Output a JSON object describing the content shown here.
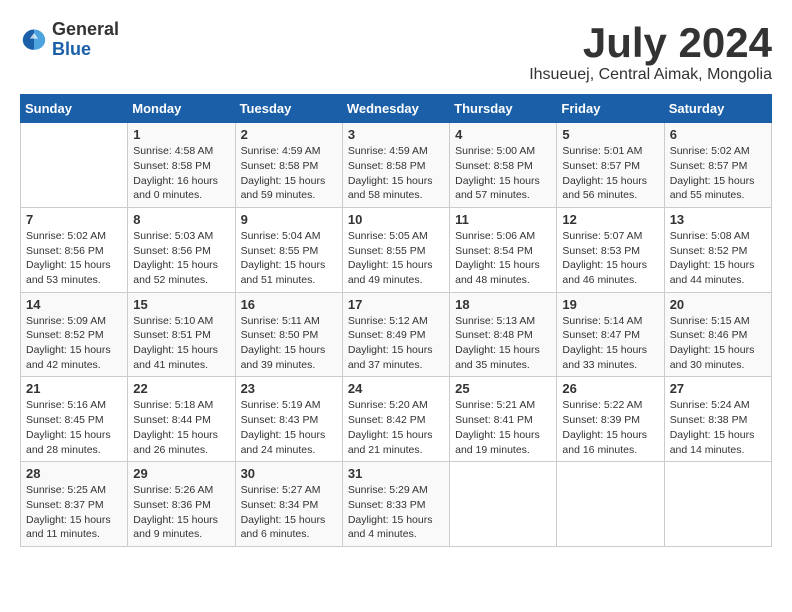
{
  "logo": {
    "general": "General",
    "blue": "Blue"
  },
  "title": {
    "month": "July 2024",
    "location": "Ihsueuej, Central Aimak, Mongolia"
  },
  "headers": [
    "Sunday",
    "Monday",
    "Tuesday",
    "Wednesday",
    "Thursday",
    "Friday",
    "Saturday"
  ],
  "weeks": [
    [
      {
        "day": "",
        "info": ""
      },
      {
        "day": "1",
        "info": "Sunrise: 4:58 AM\nSunset: 8:58 PM\nDaylight: 16 hours\nand 0 minutes."
      },
      {
        "day": "2",
        "info": "Sunrise: 4:59 AM\nSunset: 8:58 PM\nDaylight: 15 hours\nand 59 minutes."
      },
      {
        "day": "3",
        "info": "Sunrise: 4:59 AM\nSunset: 8:58 PM\nDaylight: 15 hours\nand 58 minutes."
      },
      {
        "day": "4",
        "info": "Sunrise: 5:00 AM\nSunset: 8:58 PM\nDaylight: 15 hours\nand 57 minutes."
      },
      {
        "day": "5",
        "info": "Sunrise: 5:01 AM\nSunset: 8:57 PM\nDaylight: 15 hours\nand 56 minutes."
      },
      {
        "day": "6",
        "info": "Sunrise: 5:02 AM\nSunset: 8:57 PM\nDaylight: 15 hours\nand 55 minutes."
      }
    ],
    [
      {
        "day": "7",
        "info": "Sunrise: 5:02 AM\nSunset: 8:56 PM\nDaylight: 15 hours\nand 53 minutes."
      },
      {
        "day": "8",
        "info": "Sunrise: 5:03 AM\nSunset: 8:56 PM\nDaylight: 15 hours\nand 52 minutes."
      },
      {
        "day": "9",
        "info": "Sunrise: 5:04 AM\nSunset: 8:55 PM\nDaylight: 15 hours\nand 51 minutes."
      },
      {
        "day": "10",
        "info": "Sunrise: 5:05 AM\nSunset: 8:55 PM\nDaylight: 15 hours\nand 49 minutes."
      },
      {
        "day": "11",
        "info": "Sunrise: 5:06 AM\nSunset: 8:54 PM\nDaylight: 15 hours\nand 48 minutes."
      },
      {
        "day": "12",
        "info": "Sunrise: 5:07 AM\nSunset: 8:53 PM\nDaylight: 15 hours\nand 46 minutes."
      },
      {
        "day": "13",
        "info": "Sunrise: 5:08 AM\nSunset: 8:52 PM\nDaylight: 15 hours\nand 44 minutes."
      }
    ],
    [
      {
        "day": "14",
        "info": "Sunrise: 5:09 AM\nSunset: 8:52 PM\nDaylight: 15 hours\nand 42 minutes."
      },
      {
        "day": "15",
        "info": "Sunrise: 5:10 AM\nSunset: 8:51 PM\nDaylight: 15 hours\nand 41 minutes."
      },
      {
        "day": "16",
        "info": "Sunrise: 5:11 AM\nSunset: 8:50 PM\nDaylight: 15 hours\nand 39 minutes."
      },
      {
        "day": "17",
        "info": "Sunrise: 5:12 AM\nSunset: 8:49 PM\nDaylight: 15 hours\nand 37 minutes."
      },
      {
        "day": "18",
        "info": "Sunrise: 5:13 AM\nSunset: 8:48 PM\nDaylight: 15 hours\nand 35 minutes."
      },
      {
        "day": "19",
        "info": "Sunrise: 5:14 AM\nSunset: 8:47 PM\nDaylight: 15 hours\nand 33 minutes."
      },
      {
        "day": "20",
        "info": "Sunrise: 5:15 AM\nSunset: 8:46 PM\nDaylight: 15 hours\nand 30 minutes."
      }
    ],
    [
      {
        "day": "21",
        "info": "Sunrise: 5:16 AM\nSunset: 8:45 PM\nDaylight: 15 hours\nand 28 minutes."
      },
      {
        "day": "22",
        "info": "Sunrise: 5:18 AM\nSunset: 8:44 PM\nDaylight: 15 hours\nand 26 minutes."
      },
      {
        "day": "23",
        "info": "Sunrise: 5:19 AM\nSunset: 8:43 PM\nDaylight: 15 hours\nand 24 minutes."
      },
      {
        "day": "24",
        "info": "Sunrise: 5:20 AM\nSunset: 8:42 PM\nDaylight: 15 hours\nand 21 minutes."
      },
      {
        "day": "25",
        "info": "Sunrise: 5:21 AM\nSunset: 8:41 PM\nDaylight: 15 hours\nand 19 minutes."
      },
      {
        "day": "26",
        "info": "Sunrise: 5:22 AM\nSunset: 8:39 PM\nDaylight: 15 hours\nand 16 minutes."
      },
      {
        "day": "27",
        "info": "Sunrise: 5:24 AM\nSunset: 8:38 PM\nDaylight: 15 hours\nand 14 minutes."
      }
    ],
    [
      {
        "day": "28",
        "info": "Sunrise: 5:25 AM\nSunset: 8:37 PM\nDaylight: 15 hours\nand 11 minutes."
      },
      {
        "day": "29",
        "info": "Sunrise: 5:26 AM\nSunset: 8:36 PM\nDaylight: 15 hours\nand 9 minutes."
      },
      {
        "day": "30",
        "info": "Sunrise: 5:27 AM\nSunset: 8:34 PM\nDaylight: 15 hours\nand 6 minutes."
      },
      {
        "day": "31",
        "info": "Sunrise: 5:29 AM\nSunset: 8:33 PM\nDaylight: 15 hours\nand 4 minutes."
      },
      {
        "day": "",
        "info": ""
      },
      {
        "day": "",
        "info": ""
      },
      {
        "day": "",
        "info": ""
      }
    ]
  ]
}
